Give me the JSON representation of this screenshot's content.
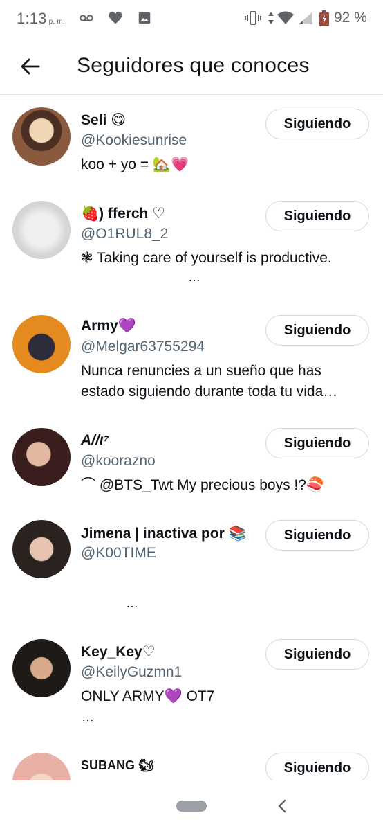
{
  "status_bar": {
    "time": "1:13",
    "ampm": "p. m.",
    "battery_text": "92 %",
    "icons": [
      "voicemail-icon",
      "heart-icon",
      "image-icon",
      "vibrate-icon",
      "data-icon",
      "wifi-icon",
      "signal-icon",
      "battery-icon"
    ]
  },
  "header": {
    "back_icon": "arrow-left-icon",
    "title": "Seguidores que conoces"
  },
  "users": [
    {
      "name": "Seli 😋",
      "handle": "@Kookiesunrise",
      "bio": "koo + yo = 🏡💗",
      "bio2": "",
      "more": "",
      "button": "Siguiendo"
    },
    {
      "name": "🍓) fferch ♡",
      "handle": "@O1RUL8_2",
      "bio": "❃ Taking care of yourself is productive.",
      "bio2": "",
      "more": "…",
      "button": "Siguiendo"
    },
    {
      "name": "Army💜",
      "handle": "@Melgar63755294",
      "bio": "Nunca renuncies a un sueño que has",
      "bio2": "estado siguiendo durante toda tu vida…",
      "more": "",
      "button": "Siguiendo"
    },
    {
      "name": "A//ι⁷",
      "handle": "@koorazno",
      "bio": "⌒ @BTS_Twt My precious boys !?🍣",
      "bio2": "",
      "more": "",
      "button": "Siguiendo"
    },
    {
      "name": "Jimena | inactiva por 📚",
      "handle": "@K00TIME",
      "bio": "",
      "bio2": "",
      "more": "…",
      "button": "Siguiendo"
    },
    {
      "name": "Key_Key♡",
      "handle": "@KeilyGuzmn1",
      "bio": "ONLY ARMY💜 OT7",
      "bio2": "",
      "more": "…",
      "button": "Siguiendo"
    },
    {
      "name": "SUBANG 🐿",
      "handle": "",
      "bio": "",
      "bio2": "",
      "more": "",
      "button": "Siguiendo"
    }
  ],
  "colors": {
    "text_primary": "#0f1419",
    "text_secondary": "#536471",
    "border": "#cfd9de",
    "statusbar_text": "#5f6368"
  }
}
